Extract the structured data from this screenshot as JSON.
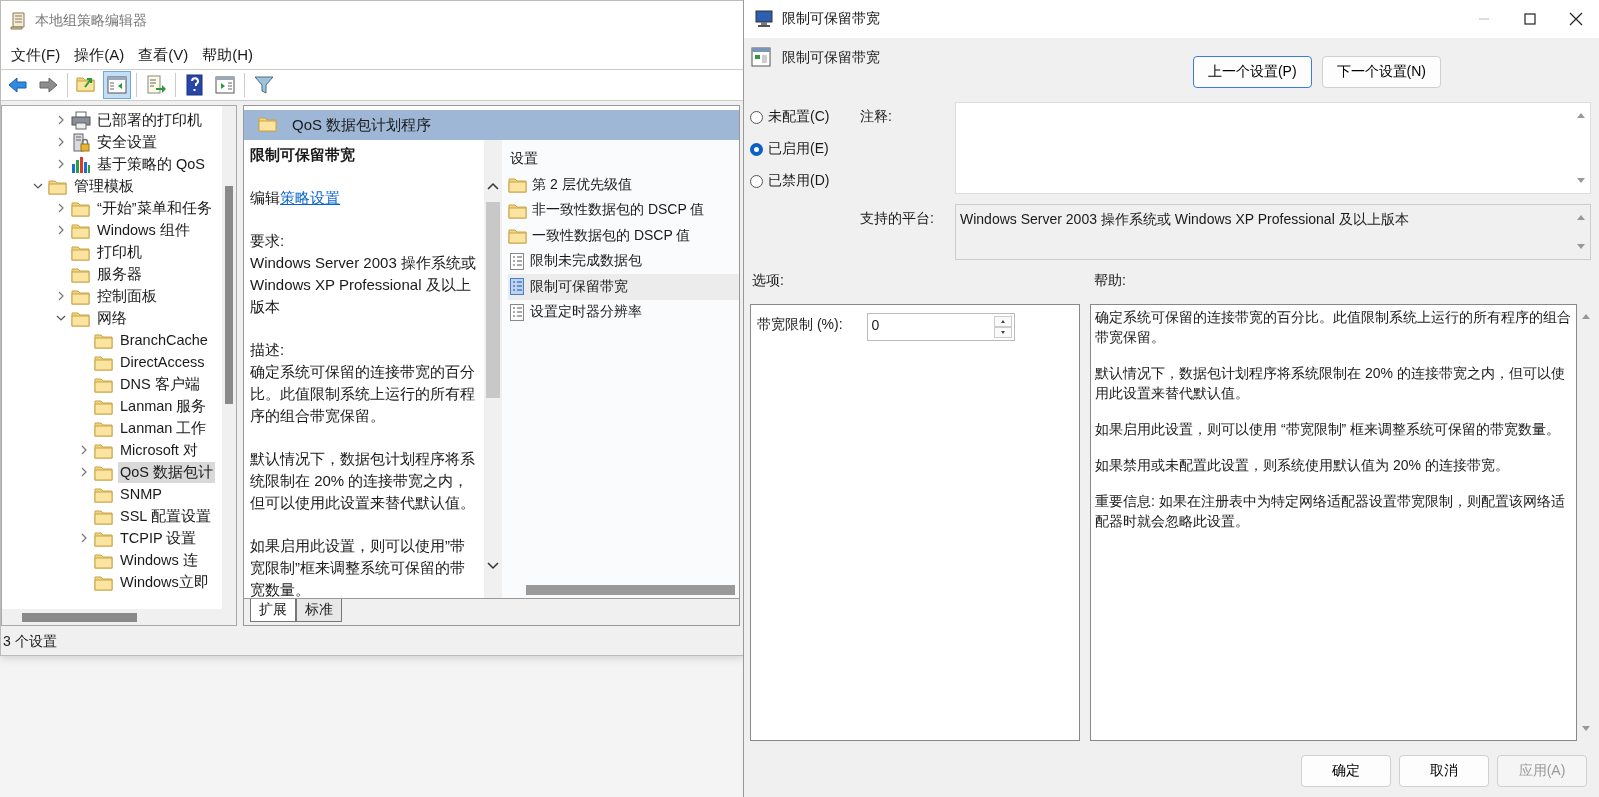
{
  "window": {
    "title": "本地组策略编辑器"
  },
  "menu": [
    "文件(F)",
    "操作(A)",
    "查看(V)",
    "帮助(H)"
  ],
  "toolbar": [
    [
      {
        "kind": "back",
        "pressed": false
      },
      {
        "kind": "forward",
        "pressed": false
      }
    ],
    [
      {
        "kind": "up",
        "pressed": false
      },
      {
        "kind": "tree",
        "pressed": true
      }
    ],
    [
      {
        "kind": "export",
        "pressed": false
      }
    ],
    [
      {
        "kind": "help",
        "pressed": false
      },
      {
        "kind": "pane",
        "pressed": false
      }
    ],
    [
      {
        "kind": "filter",
        "pressed": false
      }
    ]
  ],
  "tree": {
    "partial_branch": [
      {
        "label": "已部署的打印机",
        "kind": "printer",
        "expanded": false,
        "selected": false
      },
      {
        "label": "安全设置",
        "kind": "lock",
        "expanded": false,
        "selected": false
      },
      {
        "label": "基于策略的 QoS",
        "kind": "chart",
        "expanded": false,
        "selected": false
      }
    ],
    "items": [
      {
        "label": "管理模板",
        "kind": "folder",
        "expanded": true,
        "selected": false,
        "children": [
          {
            "label": "“开始”菜单和任务",
            "kind": "folder",
            "expanded": false,
            "selected": false
          },
          {
            "label": "Windows 组件",
            "kind": "folder",
            "expanded": false,
            "selected": false
          },
          {
            "label": "打印机",
            "kind": "folder",
            "selected": false
          },
          {
            "label": "服务器",
            "kind": "folder",
            "selected": false
          },
          {
            "label": "控制面板",
            "kind": "folder",
            "expanded": false,
            "selected": false
          },
          {
            "label": "网络",
            "kind": "folder",
            "expanded": true,
            "selected": false,
            "children": [
              {
                "label": "BranchCache",
                "kind": "folder",
                "selected": false
              },
              {
                "label": "DirectAccess",
                "kind": "folder",
                "selected": false
              },
              {
                "label": "DNS 客户端",
                "kind": "folder",
                "selected": false
              },
              {
                "label": "Lanman 服务",
                "kind": "folder",
                "selected": false
              },
              {
                "label": "Lanman 工作",
                "kind": "folder",
                "selected": false
              },
              {
                "label": "Microsoft 对",
                "kind": "folder",
                "expanded": false,
                "selected": false
              },
              {
                "label": "QoS 数据包计",
                "kind": "folder",
                "expanded": false,
                "selected": true
              },
              {
                "label": "SNMP",
                "kind": "folder",
                "selected": false
              },
              {
                "label": "SSL 配置设置",
                "kind": "folder",
                "selected": false
              },
              {
                "label": "TCPIP 设置",
                "kind": "folder",
                "expanded": false,
                "selected": false
              },
              {
                "label": "Windows 连",
                "kind": "folder",
                "selected": false
              },
              {
                "label": "Windows立即",
                "kind": "folder",
                "selected": false
              }
            ]
          }
        ]
      }
    ]
  },
  "details": {
    "header": "QoS 数据包计划程序",
    "title": "限制可保留带宽",
    "edit_prefix": "编辑",
    "edit_link": "策略设置",
    "requirements_label": "要求:",
    "requirements": "Windows Server 2003 操作系统或 Windows XP Professional 及以上版本",
    "description_label": "描述:",
    "description": [
      "确定系统可保留的连接带宽的百分比。此值限制系统上运行的所有程序的组合带宽保留。",
      "默认情况下，数据包计划程序将系统限制在 20% 的连接带宽之内，但可以使用此设置来替代默认值。",
      "如果启用此设置，则可以使用”带宽限制”框来调整系统可保留的带宽数量。"
    ]
  },
  "settings": {
    "header": "设置",
    "items": [
      {
        "label": "第 2 层优先级值",
        "kind": "folder",
        "selected": false
      },
      {
        "label": "非一致性数据包的 DSCP 值",
        "kind": "folder",
        "selected": false
      },
      {
        "label": "一致性数据包的 DSCP 值",
        "kind": "folder",
        "selected": false
      },
      {
        "label": "限制未完成数据包",
        "kind": "setting",
        "selected": false
      },
      {
        "label": "限制可保留带宽",
        "kind": "setting",
        "selected": true
      },
      {
        "label": "设置定时器分辨率",
        "kind": "setting",
        "selected": false
      }
    ]
  },
  "view_tabs": [
    {
      "label": "扩展",
      "selected": true
    },
    {
      "label": "标准",
      "selected": false
    }
  ],
  "status_bar": "3 个设置",
  "dialog": {
    "title": "限制可保留带宽",
    "heading": "限制可保留带宽",
    "nav_buttons": [
      {
        "label": "上一个设置(P)",
        "focused": true
      },
      {
        "label": "下一个设置(N)",
        "focused": false
      }
    ],
    "states": [
      {
        "label": "未配置(C)",
        "selected": false
      },
      {
        "label": "已启用(E)",
        "selected": true
      },
      {
        "label": "已禁用(D)",
        "selected": false
      }
    ],
    "comment_label": "注释:",
    "platform_label": "支持的平台:",
    "platform": "Windows Server 2003 操作系统或 Windows XP Professional 及以上版本",
    "options_label": "选项:",
    "help_label": "帮助:",
    "option": {
      "label": "带宽限制 (%):",
      "value": "0"
    },
    "help": [
      "确定系统可保留的连接带宽的百分比。此值限制系统上运行的所有程序的组合带宽保留。",
      "默认情况下，数据包计划程序将系统限制在 20% 的连接带宽之内，但可以使用此设置来替代默认值。",
      "如果启用此设置，则可以使用 “带宽限制” 框来调整系统可保留的带宽数量。",
      "如果禁用或未配置此设置，则系统使用默认值为 20% 的连接带宽。",
      "重要信息: 如果在注册表中为特定网络适配器设置带宽限制，则配置该网络适配器时就会忽略此设置。"
    ],
    "buttons": [
      {
        "label": "确定",
        "disabled": false
      },
      {
        "label": "取消",
        "disabled": false
      },
      {
        "label": "应用(A)",
        "disabled": true
      }
    ]
  }
}
